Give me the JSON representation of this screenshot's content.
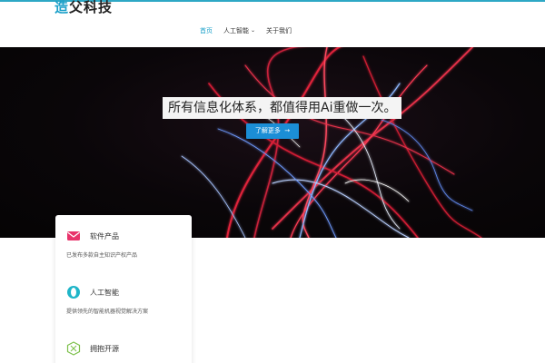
{
  "header": {
    "logo_part1": "造",
    "logo_part2": "父科技"
  },
  "nav": {
    "items": [
      {
        "label": "首页",
        "active": true
      },
      {
        "label": "人工智能",
        "has_dropdown": true
      },
      {
        "label": "关于我们"
      }
    ]
  },
  "hero": {
    "headline": "所有信息化体系，都值得用Ai重做一次。",
    "cta_label": "了解更多",
    "cta_arrow": "→"
  },
  "features": [
    {
      "icon": "envelope-icon",
      "title": "软件产品",
      "desc": "已发布多款自主知识产权产品"
    },
    {
      "icon": "ring-icon",
      "title": "人工智能",
      "desc": "提供领先的智能机器视觉解决方案"
    },
    {
      "icon": "hexagon-icon",
      "title": "拥抱开源",
      "desc": ""
    }
  ],
  "colors": {
    "accent": "#1ba0c9",
    "button": "#1b8ed6",
    "envelope": "#e8336b"
  }
}
